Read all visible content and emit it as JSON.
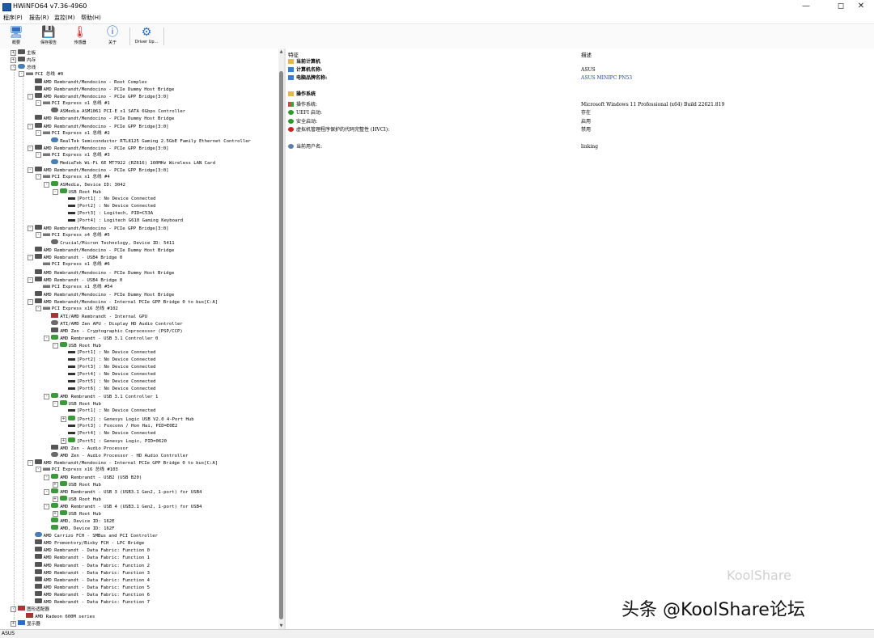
{
  "window": {
    "title": "HWiNFO64 v7.36-4960"
  },
  "menu": [
    "程序(P)",
    "报告(R)",
    "监控(M)",
    "帮助(H)"
  ],
  "toolbar": [
    {
      "label": "概要",
      "icon": "monitor-icon"
    },
    {
      "label": "保存报告",
      "icon": "save-icon"
    },
    {
      "label": "传感器",
      "icon": "thermometer-icon"
    },
    {
      "label": "关于",
      "icon": "info-icon"
    },
    {
      "label": "Driver Up...",
      "icon": "driver-update-icon"
    }
  ],
  "tree": [
    {
      "t": "主板",
      "l": 1,
      "e": "+",
      "i": "chip"
    },
    {
      "t": "内存",
      "l": 1,
      "e": "+",
      "i": "chip"
    },
    {
      "t": "总线",
      "l": 1,
      "e": "-",
      "i": "net"
    },
    {
      "t": "PCI 总线 #0",
      "l": 2,
      "e": "-",
      "i": "bus"
    },
    {
      "t": "AMD Rembrandt/Mendocino - Root Complex",
      "l": 3,
      "i": "chip"
    },
    {
      "t": "AMD Rembrandt/Mendocino - PCIe Dummy Host Bridge",
      "l": 3,
      "i": "chip"
    },
    {
      "t": "AMD Rembrandt/Mendocino - PCIe GPP Bridge[3:0]",
      "l": 3,
      "e": "-",
      "i": "chip"
    },
    {
      "t": "PCI Express x1 总线 #1",
      "l": 4,
      "e": "-",
      "i": "bus"
    },
    {
      "t": "ASMedia ASM1061 PCI-E x1 SATA 6Gbps Controller",
      "l": 5,
      "i": "disk"
    },
    {
      "t": "AMD Rembrandt/Mendocino - PCIe Dummy Host Bridge",
      "l": 3,
      "i": "chip"
    },
    {
      "t": "AMD Rembrandt/Mendocino - PCIe GPP Bridge[3:0]",
      "l": 3,
      "e": "-",
      "i": "chip"
    },
    {
      "t": "PCI Express x1 总线 #2",
      "l": 4,
      "e": "-",
      "i": "bus"
    },
    {
      "t": "RealTek Semiconductor RTL8125 Gaming 2.5GbE Family Ethernet Controller",
      "l": 5,
      "i": "net"
    },
    {
      "t": "AMD Rembrandt/Mendocino - PCIe GPP Bridge[3:0]",
      "l": 3,
      "e": "-",
      "i": "chip"
    },
    {
      "t": "PCI Express x1 总线 #3",
      "l": 4,
      "e": "-",
      "i": "bus"
    },
    {
      "t": "MediaTek Wi-Fi 6E MT7922 (RZ616) 160MHz Wireless LAN Card",
      "l": 5,
      "i": "net"
    },
    {
      "t": "AMD Rembrandt/Mendocino - PCIe GPP Bridge[3:0]",
      "l": 3,
      "e": "-",
      "i": "chip"
    },
    {
      "t": "PCI Express x1 总线 #4",
      "l": 4,
      "e": "-",
      "i": "bus"
    },
    {
      "t": "ASMedia, Device ID: 3042",
      "l": 5,
      "e": "-",
      "i": "usb"
    },
    {
      "t": "USB Root Hub",
      "l": 6,
      "e": "-",
      "i": "usb"
    },
    {
      "t": "[Port1] : No Device Connected",
      "l": 7,
      "i": "port"
    },
    {
      "t": "[Port2] : No Device Connected",
      "l": 7,
      "i": "port"
    },
    {
      "t": "[Port3] : Logitech, PID=C53A",
      "l": 7,
      "i": "port"
    },
    {
      "t": "[Port4] : Logitech G610 Gaming Keyboard",
      "l": 7,
      "i": "port"
    },
    {
      "t": "AMD Rembrandt/Mendocino - PCIe GPP Bridge[3:0]",
      "l": 3,
      "e": "-",
      "i": "chip"
    },
    {
      "t": "PCI Express x4 总线 #5",
      "l": 4,
      "e": "-",
      "i": "bus"
    },
    {
      "t": "Crucial/Micron Technology, Device ID: 5411",
      "l": 5,
      "i": "disk"
    },
    {
      "t": "AMD Rembrandt/Mendocino - PCIe Dummy Host Bridge",
      "l": 3,
      "i": "chip"
    },
    {
      "t": "AMD Rembrandt - USB4 Bridge 0",
      "l": 3,
      "e": "-",
      "i": "chip"
    },
    {
      "t": "PCI Express x1 总线 #6",
      "l": 4,
      "i": "bus"
    },
    {
      "t": "AMD Rembrandt/Mendocino - PCIe Dummy Host Bridge",
      "l": 3,
      "i": "chip"
    },
    {
      "t": "AMD Rembrandt - USB4 Bridge 0",
      "l": 3,
      "e": "-",
      "i": "chip"
    },
    {
      "t": "PCI Express x1 总线 #54",
      "l": 4,
      "i": "bus"
    },
    {
      "t": "AMD Rembrandt/Mendocino - PCIe Dummy Host Bridge",
      "l": 3,
      "i": "chip"
    },
    {
      "t": "AMD Rembrandt/Mendocino - Internal PCIe GPP Bridge 0 to bus[C:A]",
      "l": 3,
      "e": "-",
      "i": "chip"
    },
    {
      "t": "PCI Express x16 总线 #102",
      "l": 4,
      "e": "-",
      "i": "bus"
    },
    {
      "t": "ATI/AMD Rembrandt - Internal GPU",
      "l": 5,
      "i": "gpu"
    },
    {
      "t": "ATI/AMD Zen APU - Display HD Audio Controller",
      "l": 5,
      "i": "disk"
    },
    {
      "t": "AMD Zen - Cryptographic Coprocessor (PSP/CCP)",
      "l": 5,
      "i": "chip"
    },
    {
      "t": "AMD Rembrandt - USB 3.1 Controller 0",
      "l": 5,
      "e": "-",
      "i": "usb"
    },
    {
      "t": "USB Root Hub",
      "l": 6,
      "e": "-",
      "i": "usb"
    },
    {
      "t": "[Port1] : No Device Connected",
      "l": 7,
      "i": "port"
    },
    {
      "t": "[Port2] : No Device Connected",
      "l": 7,
      "i": "port"
    },
    {
      "t": "[Port3] : No Device Connected",
      "l": 7,
      "i": "port"
    },
    {
      "t": "[Port4] : No Device Connected",
      "l": 7,
      "i": "port"
    },
    {
      "t": "[Port5] : No Device Connected",
      "l": 7,
      "i": "port"
    },
    {
      "t": "[Port6] : No Device Connected",
      "l": 7,
      "i": "port"
    },
    {
      "t": "AMD Rembrandt - USB 3.1 Controller 1",
      "l": 5,
      "e": "-",
      "i": "usb"
    },
    {
      "t": "USB Root Hub",
      "l": 6,
      "e": "-",
      "i": "usb"
    },
    {
      "t": "[Port1] : No Device Connected",
      "l": 7,
      "i": "port"
    },
    {
      "t": "[Port2] : Genesys Logic USB V2.0 4-Port Hub",
      "l": 7,
      "e": "+",
      "i": "usb"
    },
    {
      "t": "[Port3] : Foxconn / Hon Hai, PID=E0E2",
      "l": 7,
      "i": "port"
    },
    {
      "t": "[Port4] : No Device Connected",
      "l": 7,
      "i": "port"
    },
    {
      "t": "[Port5] : Genesys Logic, PID=0620",
      "l": 7,
      "e": "+",
      "i": "usb"
    },
    {
      "t": "AMD Zen - Audio Processor",
      "l": 5,
      "i": "chip"
    },
    {
      "t": "AMD Zen - Audio Processor - HD Audio Controller",
      "l": 5,
      "i": "disk"
    },
    {
      "t": "AMD Rembrandt/Mendocino - Internal PCIe GPP Bridge 0 to bus[C:A]",
      "l": 3,
      "e": "-",
      "i": "chip"
    },
    {
      "t": "PCI Express x16 总线 #103",
      "l": 4,
      "e": "-",
      "i": "bus"
    },
    {
      "t": "AMD Rembrandt - USB2 (USB B20)",
      "l": 5,
      "e": "-",
      "i": "usb"
    },
    {
      "t": "USB Root Hub",
      "l": 6,
      "e": "+",
      "i": "usb"
    },
    {
      "t": "AMD Rembrandt - USB 3 (USB3.1 Gen2, 1-port) for USB4",
      "l": 5,
      "e": "-",
      "i": "usb"
    },
    {
      "t": "USB Root Hub",
      "l": 6,
      "e": "+",
      "i": "usb"
    },
    {
      "t": "AMD Rembrandt - USB 4 (USB3.1 Gen2, 1-port) for USB4",
      "l": 5,
      "e": "-",
      "i": "usb"
    },
    {
      "t": "USB Root Hub",
      "l": 6,
      "e": "+",
      "i": "usb"
    },
    {
      "t": "AMD, Device ID: 162E",
      "l": 5,
      "i": "usb"
    },
    {
      "t": "AMD, Device ID: 162F",
      "l": 5,
      "i": "usb"
    },
    {
      "t": "AMD Carrizo FCH - SMBus and PCI Controller",
      "l": 3,
      "i": "net"
    },
    {
      "t": "AMD Promontory/Bixby FCH - LPC Bridge",
      "l": 3,
      "i": "chip"
    },
    {
      "t": "AMD Rembrandt - Data Fabric: Function 0",
      "l": 3,
      "i": "chip"
    },
    {
      "t": "AMD Rembrandt - Data Fabric: Function 1",
      "l": 3,
      "i": "chip"
    },
    {
      "t": "AMD Rembrandt - Data Fabric: Function 2",
      "l": 3,
      "i": "chip"
    },
    {
      "t": "AMD Rembrandt - Data Fabric: Function 3",
      "l": 3,
      "i": "chip"
    },
    {
      "t": "AMD Rembrandt - Data Fabric: Function 4",
      "l": 3,
      "i": "chip"
    },
    {
      "t": "AMD Rembrandt - Data Fabric: Function 5",
      "l": 3,
      "i": "chip"
    },
    {
      "t": "AMD Rembrandt - Data Fabric: Function 6",
      "l": 3,
      "i": "chip"
    },
    {
      "t": "AMD Rembrandt - Data Fabric: Function 7",
      "l": 3,
      "i": "chip"
    },
    {
      "t": "图形适配器",
      "l": 1,
      "e": "-",
      "i": "gpu"
    },
    {
      "t": "AMD Radeon 600M series",
      "l": 2,
      "i": "gpu"
    },
    {
      "t": "显示器",
      "l": 1,
      "e": "+",
      "i": "mon"
    }
  ],
  "right": {
    "col_feature": "特征",
    "col_desc": "描述",
    "rows": [
      {
        "f": "当前计算机",
        "d": "",
        "icon": "folder",
        "bold": true
      },
      {
        "f": "计算机名称:",
        "d": "ASUS",
        "icon": "pc",
        "bold": true
      },
      {
        "f": "电脑品牌名称:",
        "d": "ASUS MINIPC PN53",
        "icon": "pc",
        "bold": true,
        "link": true
      },
      {
        "f": "",
        "d": ""
      },
      {
        "f": "操作系统",
        "d": "",
        "icon": "folder",
        "bold": true
      },
      {
        "f": "操作系统:",
        "d": "Microsoft Windows 11 Professional (x64) Build 22621.819",
        "icon": "win"
      },
      {
        "f": "UEFI 启动:",
        "d": "存在",
        "icon": "ok"
      },
      {
        "f": "安全启动:",
        "d": "启用",
        "icon": "ok"
      },
      {
        "f": "虚拟机管理程序保护的代码完整性 (HVCI):",
        "d": "禁用",
        "icon": "err"
      },
      {
        "f": "",
        "d": ""
      },
      {
        "f": "当前用户名:",
        "d": "linking",
        "icon": "user"
      }
    ]
  },
  "status": "ASUS",
  "watermark": "头条 @KoolShare论坛",
  "watermark_faint": "KoolShare"
}
